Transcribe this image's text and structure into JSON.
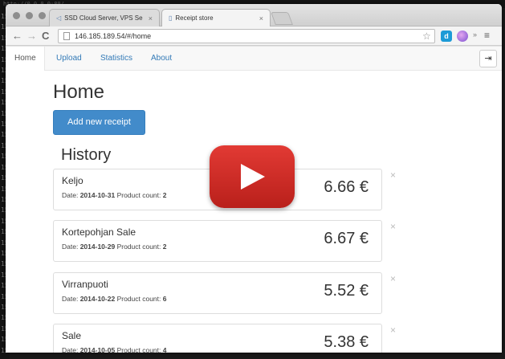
{
  "terminal": {
    "top_line": "http://0.0.0.0:80/",
    "line_prefixes": [
      "15",
      "15",
      "15",
      "15",
      "15",
      "15",
      "15",
      "15",
      "15",
      "15",
      "15",
      "15",
      "15",
      "15",
      "15",
      "15",
      "15",
      "15",
      "15",
      "15",
      "15",
      "15",
      "15",
      "15",
      "15",
      "15",
      "15",
      "15",
      "15",
      "15",
      "15",
      "15"
    ]
  },
  "browser": {
    "tabs": [
      {
        "label": "SSD Cloud Server, VPS Se"
      },
      {
        "label": "Receipt store"
      }
    ],
    "url": "146.185.189.54/#/home"
  },
  "app": {
    "nav": [
      {
        "label": "Home"
      },
      {
        "label": "Upload"
      },
      {
        "label": "Statistics"
      },
      {
        "label": "About"
      }
    ],
    "page_title": "Home",
    "add_button": "Add new receipt",
    "history_title": "History",
    "date_label": "Date:",
    "count_label": "Product count:",
    "receipts": [
      {
        "store": "Keljo",
        "date": "2014-10-31",
        "count": "2",
        "total": "6.66 €"
      },
      {
        "store": "Kortepohjan Sale",
        "date": "2014-10-29",
        "count": "2",
        "total": "6.67 €"
      },
      {
        "store": "Virranpuoti",
        "date": "2014-10-22",
        "count": "6",
        "total": "5.52 €"
      },
      {
        "store": "Sale",
        "date": "2014-10-05",
        "count": "4",
        "total": "5.38 €"
      }
    ]
  },
  "colors": {
    "primary": "#428bca",
    "link": "#337ab7",
    "play": "#e23a34"
  }
}
